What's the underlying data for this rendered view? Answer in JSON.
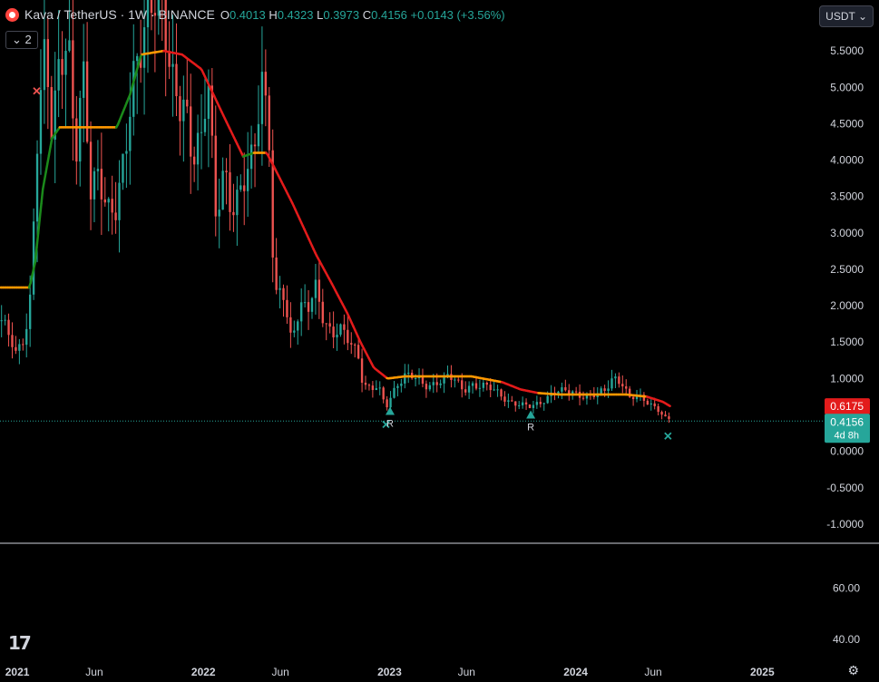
{
  "header": {
    "symbol_icon": "kava-logo-icon",
    "title": "Kava / TetherUS · 1W · BINANCE",
    "o_key": "O",
    "o_val": "0.4013",
    "h_key": "H",
    "h_val": "0.4323",
    "l_key": "L",
    "l_val": "0.3973",
    "c_key": "C",
    "c_val": "0.4156",
    "change": "+0.0143 (+3.56%)"
  },
  "indicator_toggle": "⌄ 2",
  "currency_button": "USDT ⌄",
  "badges": {
    "ma_value": "0.6175",
    "price_value": "0.4156",
    "countdown": "4d 8h"
  },
  "colors": {
    "up": "#26a69a",
    "down": "#ef5350",
    "ma_up": "#1b8a1b",
    "ma_down": "#e31b1b",
    "ma_flat": "#ff9800",
    "price_line": "#26a69a",
    "ma_badge": "#e31b1b",
    "price_badge": "#26a69a"
  },
  "chart_data": {
    "type": "candlestick",
    "symbol": "KAVA/USDT",
    "interval": "1W",
    "exchange": "BINANCE",
    "y_ticks": [
      "5.5000",
      "5.0000",
      "4.5000",
      "4.0000",
      "3.5000",
      "3.0000",
      "2.5000",
      "2.0000",
      "1.5000",
      "1.0000",
      "0.5000",
      "0.0000",
      "-0.5000",
      "-1.0000"
    ],
    "y_tick_values": [
      5.5,
      5.0,
      4.5,
      4.0,
      3.5,
      3.0,
      2.5,
      2.0,
      1.5,
      1.0,
      0.5,
      0.0,
      -0.5,
      -1.0
    ],
    "ylim": [
      -1.25,
      5.95
    ],
    "x_ticks": [
      {
        "label": "2021",
        "date": "2021-01-01",
        "bold": true
      },
      {
        "label": "Jun",
        "date": "2021-06-01",
        "bold": false
      },
      {
        "label": "2022",
        "date": "2022-01-01",
        "bold": true
      },
      {
        "label": "Jun",
        "date": "2022-06-01",
        "bold": false
      },
      {
        "label": "2023",
        "date": "2023-01-01",
        "bold": true
      },
      {
        "label": "Jun",
        "date": "2023-06-01",
        "bold": false
      },
      {
        "label": "2024",
        "date": "2024-01-01",
        "bold": true
      },
      {
        "label": "Jun",
        "date": "2024-06-01",
        "bold": false
      },
      {
        "label": "2025",
        "date": "2025-01-01",
        "bold": true
      }
    ],
    "xlim": [
      "2020-11-28",
      "2025-05-05"
    ],
    "last_price": 0.4156,
    "price_anchors": [
      [
        "2020-12-01",
        1.8
      ],
      [
        "2020-12-29",
        1.3
      ],
      [
        "2021-01-10",
        1.5
      ],
      [
        "2021-01-25",
        2.0
      ],
      [
        "2021-02-10",
        4.5
      ],
      [
        "2021-02-25",
        5.3
      ],
      [
        "2021-03-10",
        4.2
      ],
      [
        "2021-03-25",
        5.5
      ],
      [
        "2021-04-10",
        6.0
      ],
      [
        "2021-04-25",
        4.0
      ],
      [
        "2021-05-10",
        5.0
      ],
      [
        "2021-05-25",
        3.5
      ],
      [
        "2021-06-10",
        4.0
      ],
      [
        "2021-06-28",
        3.4
      ],
      [
        "2021-07-15",
        3.2
      ],
      [
        "2021-08-01",
        4.0
      ],
      [
        "2021-08-20",
        5.5
      ],
      [
        "2021-09-05",
        6.0
      ],
      [
        "2021-09-25",
        6.0
      ],
      [
        "2021-10-15",
        5.8
      ],
      [
        "2021-11-05",
        5.2
      ],
      [
        "2021-11-25",
        4.8
      ],
      [
        "2021-12-10",
        3.8
      ],
      [
        "2021-12-28",
        4.2
      ],
      [
        "2022-01-10",
        5.4
      ],
      [
        "2022-01-25",
        3.4
      ],
      [
        "2022-02-10",
        3.8
      ],
      [
        "2022-02-25",
        3.1
      ],
      [
        "2022-03-10",
        3.4
      ],
      [
        "2022-03-25",
        4.0
      ],
      [
        "2022-04-10",
        4.3
      ],
      [
        "2022-04-25",
        5.0
      ],
      [
        "2022-05-10",
        4.1
      ],
      [
        "2022-05-20",
        2.0
      ],
      [
        "2022-06-05",
        2.4
      ],
      [
        "2022-06-20",
        1.6
      ],
      [
        "2022-07-10",
        1.9
      ],
      [
        "2022-07-25",
        1.9
      ],
      [
        "2022-08-10",
        2.3
      ],
      [
        "2022-08-25",
        1.9
      ],
      [
        "2022-09-10",
        1.6
      ],
      [
        "2022-09-28",
        1.6
      ],
      [
        "2022-10-15",
        1.5
      ],
      [
        "2022-10-31",
        1.4
      ],
      [
        "2022-11-10",
        0.95
      ],
      [
        "2022-11-25",
        0.85
      ],
      [
        "2022-12-10",
        0.85
      ],
      [
        "2022-12-25",
        0.6
      ],
      [
        "2023-01-15",
        0.95
      ],
      [
        "2023-01-30",
        1.05
      ],
      [
        "2023-02-15",
        1.0
      ],
      [
        "2023-03-10",
        0.9
      ],
      [
        "2023-04-05",
        0.98
      ],
      [
        "2023-04-25",
        1.0
      ],
      [
        "2023-05-10",
        0.95
      ],
      [
        "2023-05-25",
        0.85
      ],
      [
        "2023-06-10",
        0.95
      ],
      [
        "2023-06-25",
        0.9
      ],
      [
        "2023-07-15",
        0.85
      ],
      [
        "2023-08-05",
        0.8
      ],
      [
        "2023-08-25",
        0.7
      ],
      [
        "2023-09-15",
        0.62
      ],
      [
        "2023-10-05",
        0.6
      ],
      [
        "2023-10-25",
        0.7
      ],
      [
        "2023-11-15",
        0.8
      ],
      [
        "2023-12-05",
        0.8
      ],
      [
        "2023-12-28",
        0.82
      ],
      [
        "2024-01-20",
        0.78
      ],
      [
        "2024-02-10",
        0.75
      ],
      [
        "2024-02-28",
        0.82
      ],
      [
        "2024-03-15",
        1.05
      ],
      [
        "2024-03-30",
        1.0
      ],
      [
        "2024-04-15",
        0.72
      ],
      [
        "2024-05-05",
        0.72
      ],
      [
        "2024-05-25",
        0.68
      ],
      [
        "2024-06-10",
        0.6
      ],
      [
        "2024-06-25",
        0.45
      ],
      [
        "2024-07-05",
        0.4156
      ]
    ],
    "ma_anchors": [
      [
        "2020-11-28",
        2.25
      ],
      [
        "2021-01-25",
        2.25
      ],
      [
        "2021-02-05",
        2.6
      ],
      [
        "2021-02-20",
        3.6
      ],
      [
        "2021-03-10",
        4.3
      ],
      [
        "2021-03-25",
        4.45
      ],
      [
        "2021-04-10",
        4.45
      ],
      [
        "2021-05-10",
        4.45
      ],
      [
        "2021-06-15",
        4.45
      ],
      [
        "2021-07-15",
        4.45
      ],
      [
        "2021-08-10",
        4.9
      ],
      [
        "2021-09-01",
        5.45
      ],
      [
        "2021-10-15",
        5.5
      ],
      [
        "2021-11-20",
        5.45
      ],
      [
        "2021-12-28",
        5.25
      ],
      [
        "2022-02-10",
        4.6
      ],
      [
        "2022-03-20",
        4.05
      ],
      [
        "2022-04-10",
        4.1
      ],
      [
        "2022-05-05",
        4.1
      ],
      [
        "2022-05-20",
        3.9
      ],
      [
        "2022-06-25",
        3.4
      ],
      [
        "2022-08-10",
        2.7
      ],
      [
        "2022-09-10",
        2.3
      ],
      [
        "2022-10-10",
        1.9
      ],
      [
        "2022-11-05",
        1.5
      ],
      [
        "2022-12-01",
        1.15
      ],
      [
        "2022-12-28",
        1.0
      ],
      [
        "2023-02-01",
        1.03
      ],
      [
        "2023-04-01",
        1.03
      ],
      [
        "2023-06-10",
        1.03
      ],
      [
        "2023-08-10",
        0.95
      ],
      [
        "2023-09-15",
        0.85
      ],
      [
        "2023-10-20",
        0.8
      ],
      [
        "2023-12-01",
        0.78
      ],
      [
        "2024-02-10",
        0.78
      ],
      [
        "2024-04-10",
        0.78
      ],
      [
        "2024-05-20",
        0.75
      ],
      [
        "2024-06-20",
        0.68
      ],
      [
        "2024-07-05",
        0.6175
      ]
    ],
    "ma_value": 0.6175,
    "marker_labels": [
      "R",
      "R"
    ],
    "markers": [
      {
        "type": "cross",
        "date": "2021-02-08",
        "value": 4.95,
        "color": "#ef5350"
      },
      {
        "type": "cross",
        "date": "2022-12-25",
        "value": 0.37,
        "color": "#26a69a"
      },
      {
        "type": "triangle",
        "date": "2023-01-02",
        "value": 0.55,
        "color": "#26a69a",
        "label_index": 0
      },
      {
        "type": "triangle",
        "date": "2023-10-05",
        "value": 0.5,
        "color": "#26a69a",
        "label_index": 1
      },
      {
        "type": "cross",
        "date": "2024-06-30",
        "value": 0.21,
        "color": "#26a69a"
      }
    ],
    "subpane": {
      "y_ticks": [
        "60.00",
        "40.00"
      ],
      "y_tick_values": [
        60,
        40
      ],
      "ylim": [
        33,
        77
      ]
    }
  }
}
